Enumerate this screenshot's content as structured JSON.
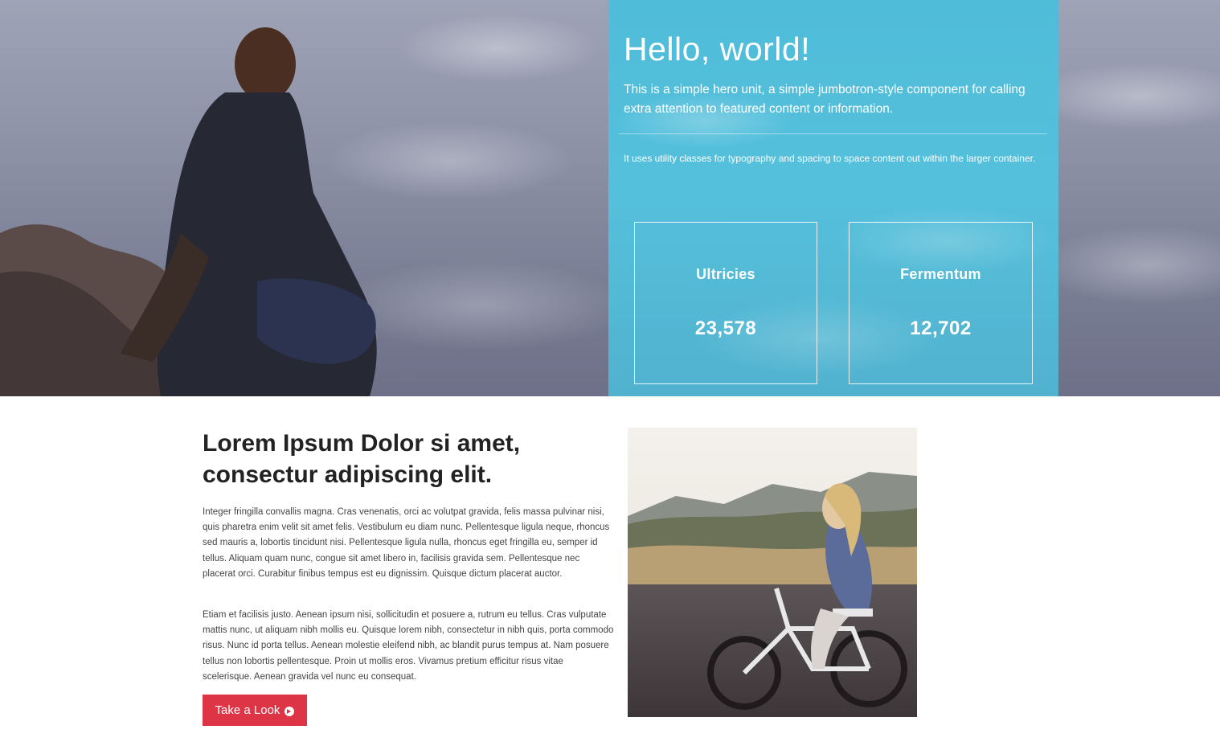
{
  "hero": {
    "title": "Hello, world!",
    "lead": "This is a simple hero unit, a simple jumbotron-style component for calling extra attention to featured content or information.",
    "small": "It uses utility classes for typography and spacing to space content out within the larger container.",
    "stats": [
      {
        "label": "Ultricies",
        "value": "23,578"
      },
      {
        "label": "Fermentum",
        "value": "12,702"
      }
    ]
  },
  "content": {
    "title": "Lorem Ipsum Dolor si amet, consectur adipiscing elit.",
    "paragraph1": "Integer fringilla convallis magna. Cras venenatis, orci ac volutpat gravida, felis massa pulvinar nisi, quis pharetra enim velit sit amet felis. Vestibulum eu diam nunc. Pellentesque ligula neque, rhoncus sed mauris a, lobortis tincidunt nisi. Pellentesque ligula nulla, rhoncus eget fringilla eu, semper id tellus. Aliquam quam nunc, congue sit amet libero in, facilisis gravida sem. Pellentesque nec placerat orci. Curabitur finibus tempus est eu dignissim. Quisque dictum placerat auctor.",
    "paragraph2": "Etiam et facilisis justo. Aenean ipsum nisi, sollicitudin et posuere a, rutrum eu tellus. Cras vulputate mattis nunc, ut aliquam nibh mollis eu. Quisque lorem nibh, consectetur in nibh quis, porta commodo risus. Nunc id porta tellus. Aenean molestie eleifend nibh, ac blandit purus tempus at. Nam posuere tellus non lobortis pellentesque. Proin ut mollis eros. Vivamus pretium efficitur risus vitae scelerisque. Aenean gravida vel nunc eu consequat.",
    "button_label": "Take a Look",
    "button_icon": "arrow-circle-right-icon"
  },
  "colors": {
    "accent": "#dd3545",
    "panel": "#4fbedd"
  }
}
